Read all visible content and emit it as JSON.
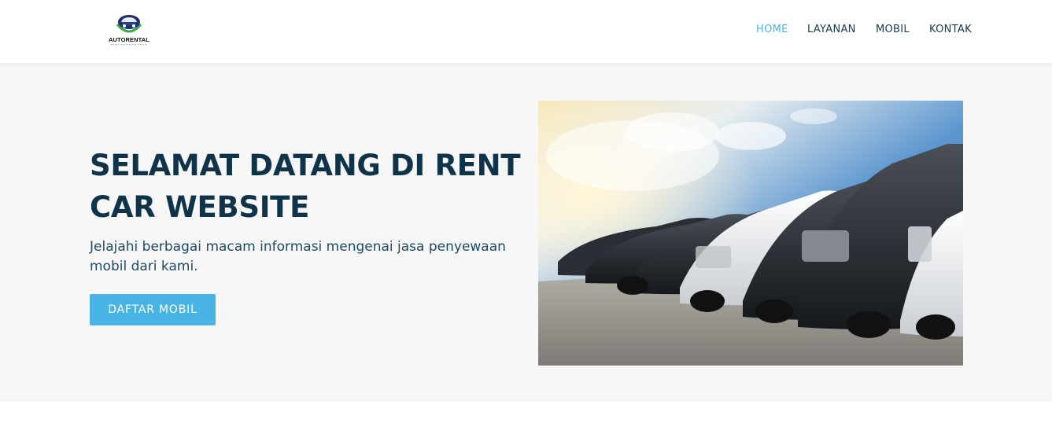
{
  "brand": {
    "logo_text": "AUTORENTAL"
  },
  "nav": {
    "items": [
      {
        "label": "HOME",
        "active": true
      },
      {
        "label": "LAYANAN",
        "active": false
      },
      {
        "label": "MOBIL",
        "active": false
      },
      {
        "label": "KONTAK",
        "active": false
      }
    ]
  },
  "hero": {
    "title": "SELAMAT DATANG DI RENT CAR WEBSITE",
    "text": "Jelajahi berbagai macam informasi mengenai jasa penyewaan mobil dari kami.",
    "button_label": "DAFTAR MOBIL",
    "image_icon": "car-lineup-photo"
  },
  "colors": {
    "accent": "#48b4e6",
    "heading": "#0f3449",
    "hero_bg": "#f7f7f7"
  }
}
